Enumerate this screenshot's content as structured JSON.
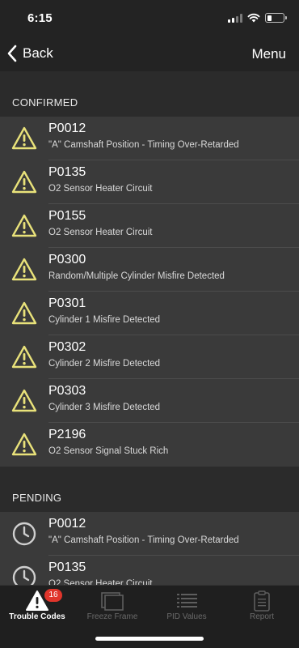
{
  "status_bar": {
    "time": "6:15",
    "battery_level": 0.3
  },
  "nav": {
    "back_label": "Back",
    "menu_label": "Menu"
  },
  "sections": {
    "confirmed": {
      "title": "CONFIRMED",
      "icon": "warning-icon",
      "items": [
        {
          "code": "P0012",
          "description": "\"A\" Camshaft Position - Timing Over-Retarded"
        },
        {
          "code": "P0135",
          "description": "O2 Sensor Heater Circuit"
        },
        {
          "code": "P0155",
          "description": "O2 Sensor Heater Circuit"
        },
        {
          "code": "P0300",
          "description": "Random/Multiple Cylinder Misfire Detected"
        },
        {
          "code": "P0301",
          "description": "Cylinder 1 Misfire Detected"
        },
        {
          "code": "P0302",
          "description": "Cylinder 2 Misfire Detected"
        },
        {
          "code": "P0303",
          "description": "Cylinder 3 Misfire Detected"
        },
        {
          "code": "P2196",
          "description": "O2 Sensor Signal Stuck Rich"
        }
      ]
    },
    "pending": {
      "title": "PENDING",
      "icon": "clock-icon",
      "items": [
        {
          "code": "P0012",
          "description": "\"A\" Camshaft Position - Timing Over-Retarded"
        },
        {
          "code": "P0135",
          "description": "O2 Sensor Heater Circuit"
        }
      ]
    }
  },
  "tabs": [
    {
      "id": "trouble-codes",
      "label": "Trouble Codes",
      "icon": "warning-icon",
      "active": true,
      "badge": "16"
    },
    {
      "id": "freeze-frame",
      "label": "Freeze Frame",
      "icon": "freeze-frame-icon",
      "active": false
    },
    {
      "id": "pid-values",
      "label": "PID Values",
      "icon": "list-icon",
      "active": false
    },
    {
      "id": "report",
      "label": "Report",
      "icon": "clipboard-icon",
      "active": false
    }
  ],
  "colors": {
    "warning_yellow": "#e9e27a",
    "clock_gray": "#cfcfcf",
    "badge_red": "#e0352b",
    "row_bg": "#3a3a3a",
    "page_bg": "#2b2b2b"
  }
}
